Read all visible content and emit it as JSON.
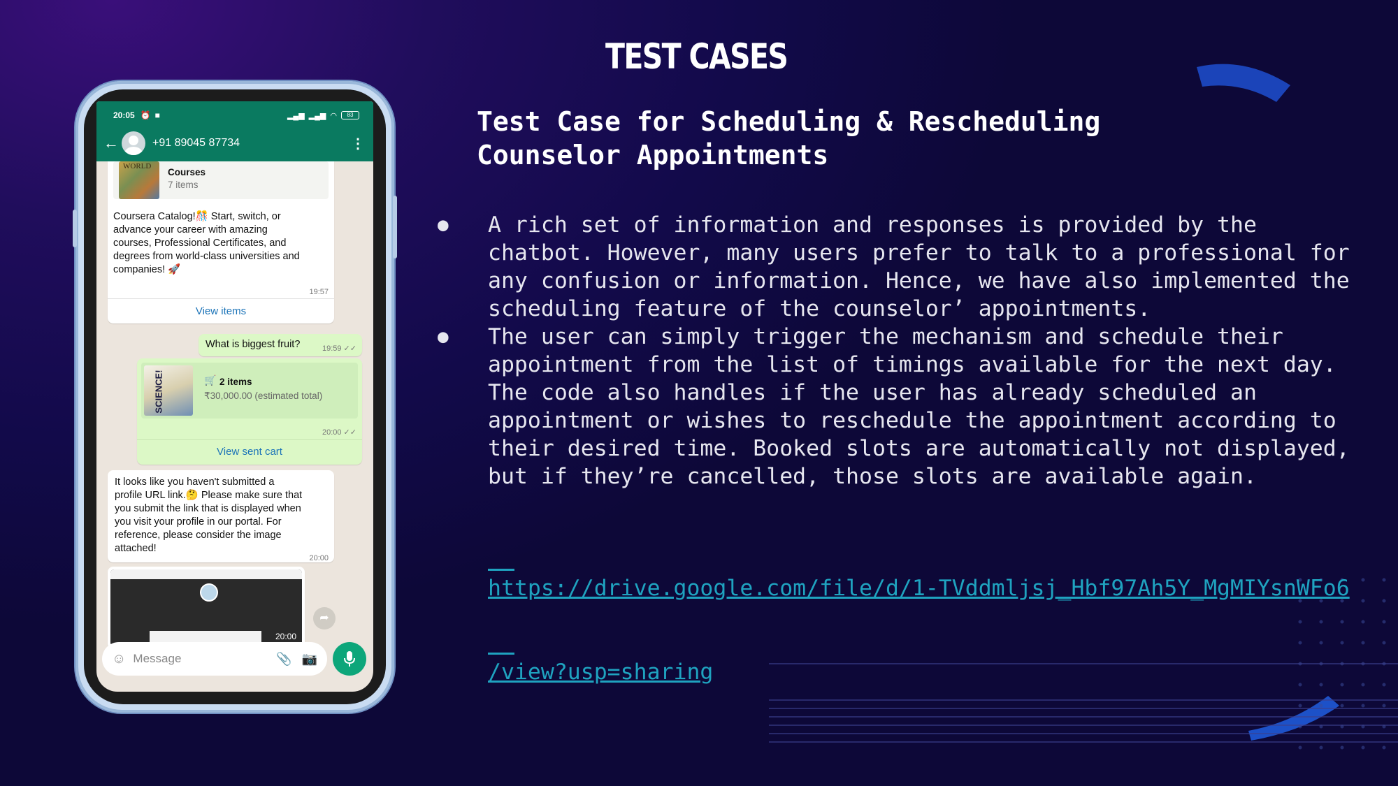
{
  "slide": {
    "title": "TEST CASES",
    "subtitle_lines": [
      "Test Case for Scheduling & Rescheduling",
      "Counselor Appointments"
    ],
    "bullet_marker": "●",
    "bullets": [
      [
        "A rich set of information and responses is provided by the",
        "chatbot. However, many users prefer to talk to a professional for",
        "any confusion or information. Hence, we have also implemented the",
        "scheduling feature of the counselor’ appointments."
      ],
      [
        "The user can simply trigger the mechanism and schedule their",
        "appointment from the list of timings available for the next day.",
        "The code also handles if the user has already scheduled an",
        "appointment or wishes to reschedule the appointment according to",
        "their desired time. Booked slots are automatically not displayed,",
        "but if they’re cancelled, those slots are available again."
      ]
    ],
    "link_lines": [
      "https://drive.google.com/file/d/1-TVddmljsj_Hbf97Ah5Y_MgMIYsnWFo6",
      "/view?usp=sharing"
    ]
  },
  "phone": {
    "status_time": "20:05",
    "battery": "83",
    "contact": "+91 89045 87734",
    "catalog_thumb_text": "WORLD",
    "catalog_title": "Courses",
    "catalog_count": "7 items",
    "msg1_lines": [
      "Coursera Catalog!🎊 Start, switch, or",
      "advance your career with amazing",
      "courses, Professional Certificates, and",
      "degrees from world-class universities and",
      "companies! 🚀"
    ],
    "msg1_time": "19:57",
    "msg1_link": "View items",
    "msg2_text": "What is biggest fruit?",
    "msg2_time": "19:59 ✓✓",
    "cart_thumb_text": "SCIENCE!",
    "cart_title": "2 items",
    "cart_total": "₹30,000.00 (estimated total)",
    "cart_time": "20:00 ✓✓",
    "cart_link": "View sent cart",
    "msg3_lines": [
      "It looks like you haven't submitted a",
      "profile URL link.🤔 Please make sure that",
      "you submit the link that is displayed when",
      "you visit your profile in our portal. For",
      "reference, please consider the image",
      "attached!"
    ],
    "msg3_time": "20:00",
    "image_time": "20:00",
    "input_placeholder": "Message",
    "colors": {
      "header": "#0a7a60",
      "outgoing": "#dcf8c6",
      "mic": "#0da67a",
      "link": "#1fa3c0"
    }
  }
}
